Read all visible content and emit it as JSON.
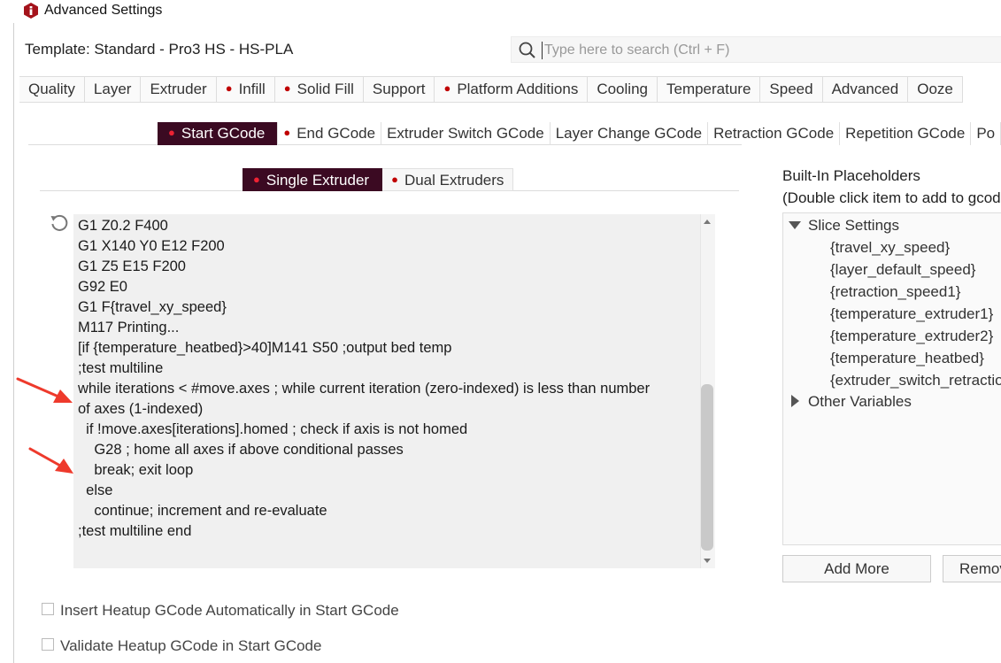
{
  "window": {
    "title": "Advanced Settings"
  },
  "header": {
    "template_label": "Template: Standard - Pro3 HS - HS-PLA",
    "search_placeholder": "Type here to search (Ctrl + F)"
  },
  "main_tabs": [
    {
      "label": "Quality",
      "dot": false
    },
    {
      "label": "Layer",
      "dot": false
    },
    {
      "label": "Extruder",
      "dot": false
    },
    {
      "label": "Infill",
      "dot": true
    },
    {
      "label": "Solid Fill",
      "dot": true
    },
    {
      "label": "Support",
      "dot": false
    },
    {
      "label": "Platform Additions",
      "dot": true
    },
    {
      "label": "Cooling",
      "dot": false
    },
    {
      "label": "Temperature",
      "dot": false
    },
    {
      "label": "Speed",
      "dot": false
    },
    {
      "label": "Advanced",
      "dot": false
    },
    {
      "label": "Ooze",
      "dot": false
    }
  ],
  "gcode_tabs": [
    {
      "label": "Start GCode",
      "dot": true,
      "active": true
    },
    {
      "label": "End GCode",
      "dot": true,
      "active": false
    },
    {
      "label": "Extruder Switch GCode",
      "dot": false,
      "active": false
    },
    {
      "label": "Layer Change GCode",
      "dot": false,
      "active": false
    },
    {
      "label": "Retraction GCode",
      "dot": false,
      "active": false
    },
    {
      "label": "Repetition GCode",
      "dot": false,
      "active": false
    },
    {
      "label": "Po",
      "dot": false,
      "active": false
    }
  ],
  "extruder_tabs": [
    {
      "label": "Single Extruder",
      "dot": true,
      "active": true
    },
    {
      "label": "Dual Extruders",
      "dot": true,
      "active": false
    }
  ],
  "editor": {
    "lines": [
      "G1 Z0.2 F400",
      "G1 X140 Y0 E12 F200",
      "G1 Z5 E15 F200",
      "G92 E0",
      "G1 F{travel_xy_speed}",
      "M117 Printing...",
      "[if {temperature_heatbed}>40]M141 S50 ;output bed temp",
      ";test multiline",
      "while iterations < #move.axes ; while current iteration (zero-indexed) is less than number",
      "of axes (1-indexed)",
      "  if !move.axes[iterations].homed ; check if axis is not homed",
      "    G28 ; home all axes if above conditional passes",
      "    break; exit loop",
      "  else",
      "    continue; increment and re-evaluate",
      ";test multiline end"
    ]
  },
  "options": {
    "insert_heatup": "Insert Heatup GCode Automatically in Start GCode",
    "validate_heatup": "Validate Heatup GCode in Start GCode"
  },
  "placeholders": {
    "title_line1": "Built-In Placeholders",
    "title_line2": "(Double click item to add to gcod",
    "slice_settings_label": "Slice Settings",
    "items": [
      "{travel_xy_speed}",
      "{layer_default_speed}",
      "{retraction_speed1}",
      "{temperature_extruder1}",
      "{temperature_extruder2}",
      "{temperature_heatbed}",
      "{extruder_switch_retractio"
    ],
    "other_variables_label": "Other Variables",
    "add_more_label": "Add More",
    "remove_label": "Remov"
  }
}
